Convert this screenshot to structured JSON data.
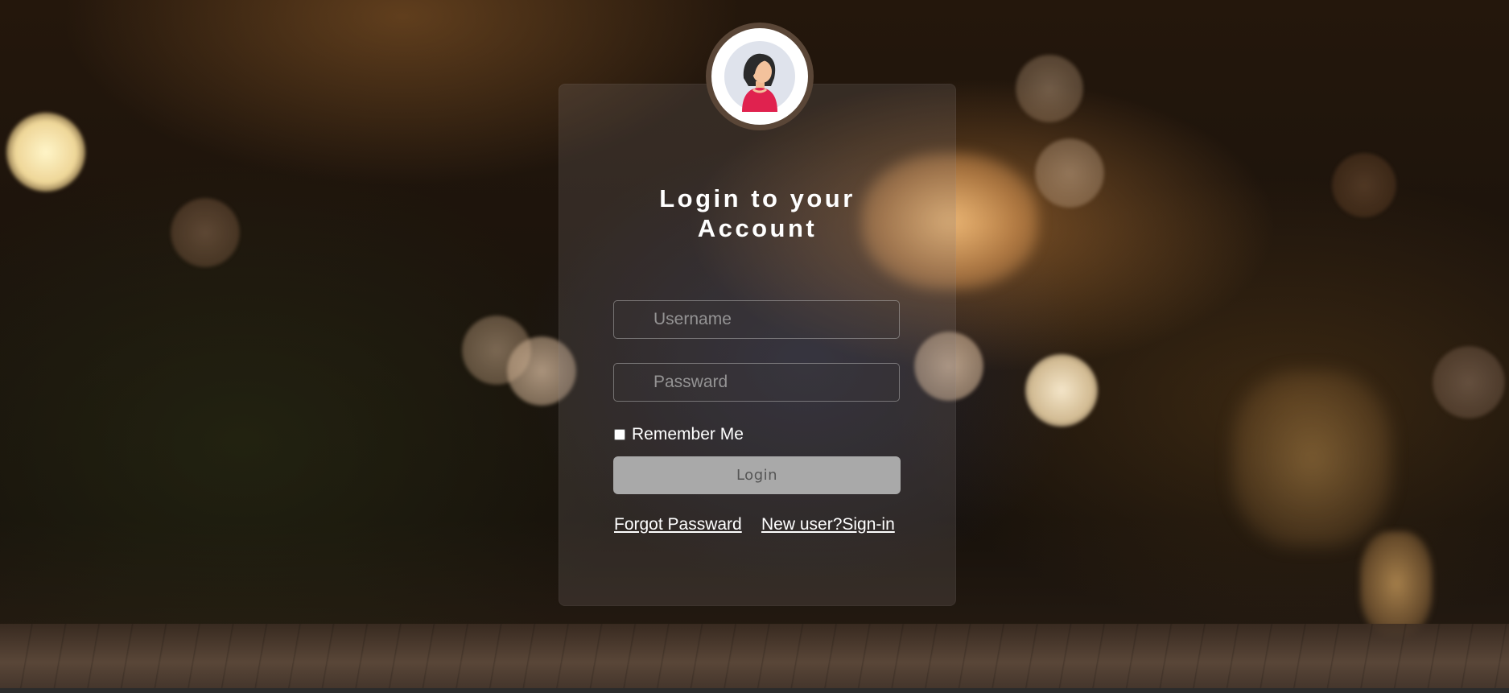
{
  "page": {
    "title": "Login to your Account"
  },
  "avatar": {
    "icon": "user-avatar-icon"
  },
  "form": {
    "username_placeholder": "Username",
    "password_placeholder": "Passward",
    "remember_label": "Remember Me",
    "remember_checked": false,
    "login_label": "Login"
  },
  "links": {
    "forgot_password": "Forgot Passward",
    "new_user": "New user?Sign-in"
  },
  "colors": {
    "card_bg": "rgba(130,125,125,0.22)",
    "button_bg": "#a9a9a9",
    "button_text": "#555555",
    "text": "#ffffff"
  }
}
